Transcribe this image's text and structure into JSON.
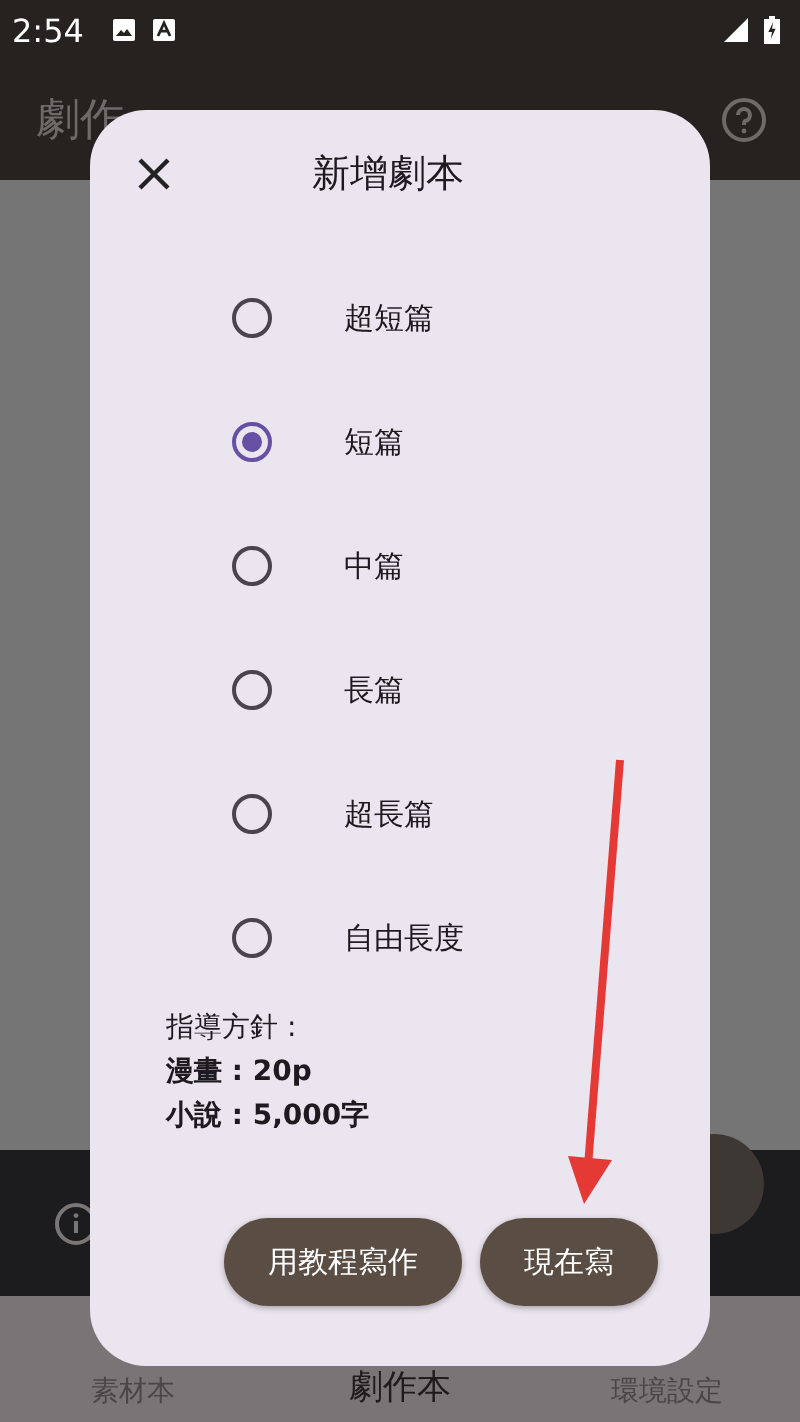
{
  "status_bar": {
    "time": "2:54"
  },
  "app_bar": {
    "title": "劇作"
  },
  "dialog": {
    "title": "新增劇本",
    "options": [
      {
        "label": "超短篇",
        "selected": false
      },
      {
        "label": "短篇",
        "selected": true
      },
      {
        "label": "中篇",
        "selected": false
      },
      {
        "label": "長篇",
        "selected": false
      },
      {
        "label": "超長篇",
        "selected": false
      },
      {
        "label": "自由長度",
        "selected": false
      }
    ],
    "guidance": [
      {
        "text": "指導方針 :",
        "bold": false
      },
      {
        "text": "漫畫 : 20p",
        "bold": true
      },
      {
        "text": "小說 : 5,000字",
        "bold": true
      }
    ],
    "buttons": [
      "用教程寫作",
      "現在寫"
    ]
  },
  "bottom_nav": [
    {
      "label": "素材本",
      "selected": false
    },
    {
      "label": "劇作本",
      "selected": true
    },
    {
      "label": "環境設定",
      "selected": false
    }
  ]
}
